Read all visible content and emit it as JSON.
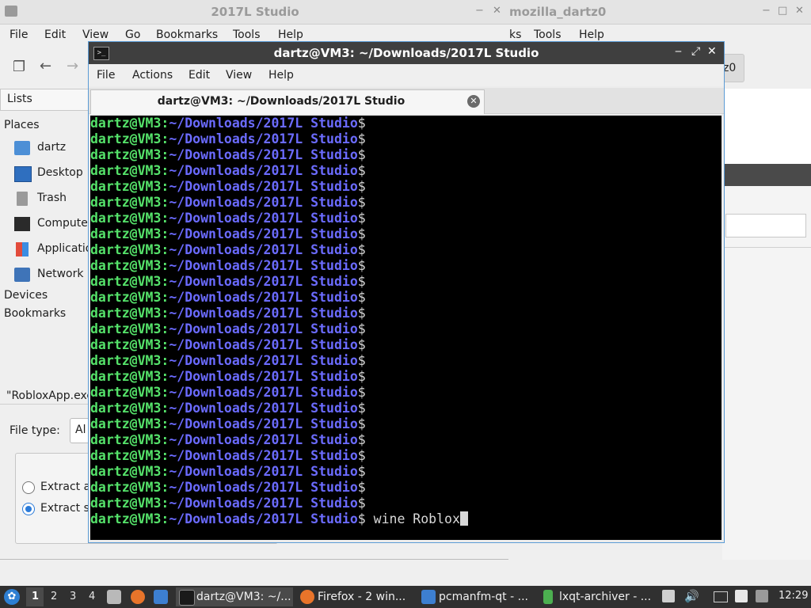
{
  "file_manager": {
    "title": "2017L Studio",
    "menu": [
      "File",
      "Edit",
      "View",
      "Go",
      "Bookmarks",
      "Tools",
      "Help"
    ],
    "lists_header": "Lists",
    "places_header": "Places",
    "places": [
      {
        "label": "dartz",
        "icon": "home-folder-icon"
      },
      {
        "label": "Desktop",
        "icon": "desktop-icon"
      },
      {
        "label": "Trash",
        "icon": "trash-icon"
      },
      {
        "label": "Compute",
        "icon": "computer-icon"
      },
      {
        "label": "Applicatio",
        "icon": "applications-icon"
      },
      {
        "label": "Network",
        "icon": "network-icon"
      }
    ],
    "devices_header": "Devices",
    "bookmarks_header": "Bookmarks",
    "filename_text": "\"RobloxApp.exe",
    "file_type_label": "File type:",
    "file_type_value": "Al",
    "radio_options": [
      {
        "label": "Extract a",
        "selected": false
      },
      {
        "label": "Extract s",
        "selected": true
      }
    ]
  },
  "firefox_window": {
    "title": "mozilla_dartz0",
    "menu_partial": "ks",
    "menu": [
      "Tools",
      "Help"
    ],
    "tab_fragment": "z0"
  },
  "terminal": {
    "title": "dartz@VM3: ~/Downloads/2017L Studio",
    "menu": [
      "File",
      "Actions",
      "Edit",
      "View",
      "Help"
    ],
    "tab_label": "dartz@VM3: ~/Downloads/2017L Studio",
    "prompt_user": "dartz@VM3",
    "prompt_sep": ":",
    "prompt_path": "~/Downloads/2017L Studio",
    "prompt_dollar": "$",
    "prompt_line_count": 26,
    "current_command": " wine Roblox",
    "colors": {
      "user": "#55e26a",
      "path": "#6b6bff",
      "background": "#000000",
      "accent": "#5b9bd5"
    }
  },
  "taskbar": {
    "workspaces": [
      "1",
      "2",
      "3",
      "4"
    ],
    "active_workspace": "1",
    "tasks": [
      {
        "label": "dartz@VM3: ~/...",
        "icon": "terminal-icon",
        "active": true
      },
      {
        "label": "Firefox - 2 win...",
        "icon": "firefox-icon",
        "active": false
      },
      {
        "label": "pcmanfm-qt - ...",
        "icon": "folder-icon",
        "active": false
      },
      {
        "label": "lxqt-archiver - ...",
        "icon": "archive-icon",
        "active": false
      }
    ],
    "clock": "12:29"
  }
}
